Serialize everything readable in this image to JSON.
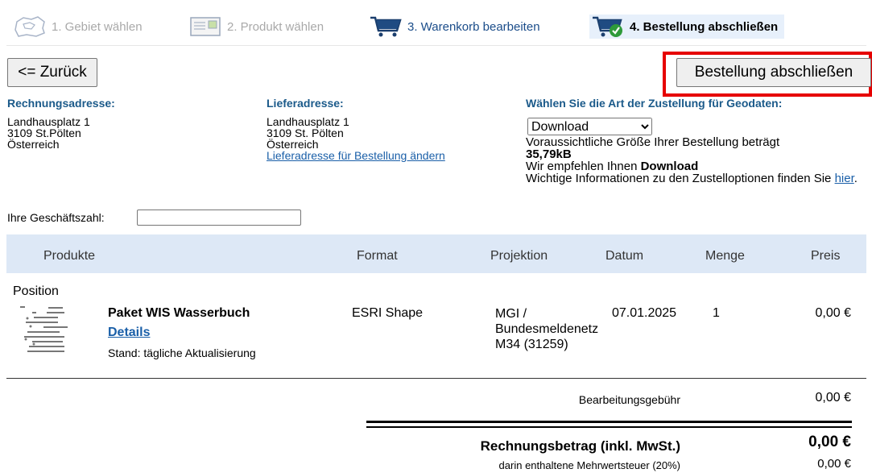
{
  "steps": [
    {
      "label": "1. Gebiet wählen",
      "icon": "map-region-icon",
      "state": "inactive"
    },
    {
      "label": "2. Produkt wählen",
      "icon": "product-sheet-icon",
      "state": "inactive"
    },
    {
      "label": "3. Warenkorb bearbeiten",
      "icon": "shopping-cart-icon",
      "state": "active"
    },
    {
      "label": "4. Bestellung abschließen",
      "icon": "cart-check-icon",
      "state": "current"
    }
  ],
  "nav": {
    "back_label": "<= Zurück",
    "finish_label": "Bestellung abschließen"
  },
  "billing": {
    "heading": "Rechnungsadresse:",
    "line1": "Landhausplatz 1",
    "line2": "3109 St.Pölten",
    "line3": "Österreich"
  },
  "delivery": {
    "heading": "Lieferadresse:",
    "line1": "Landhausplatz 1",
    "line2": "3109 St. Pölten",
    "line3": "Österreich",
    "change_link": "Lieferadresse für Bestellung ändern"
  },
  "shipping": {
    "heading": "Wählen Sie die Art der Zustellung für Geodaten:",
    "selected": "Download",
    "size_text": "Voraussichtliche Größe Ihrer Bestellung beträgt",
    "size_value": "35,79kB",
    "recommend_prefix": "Wir empfehlen Ihnen ",
    "recommend_value": "Download",
    "info_text": "Wichtige Informationen zu den Zustelloptionen finden Sie ",
    "info_link": "hier",
    "info_suffix": "."
  },
  "reference": {
    "label": "Ihre Geschäftszahl:",
    "value": ""
  },
  "table": {
    "headers": {
      "products": "Produkte",
      "format": "Format",
      "projection": "Projektion",
      "date": "Datum",
      "quantity": "Menge",
      "price": "Preis"
    },
    "position_label": "Position",
    "rows": [
      {
        "name": "Paket WIS Wasserbuch",
        "details": "Details",
        "status": "Stand: tägliche Aktualisierung",
        "format": "ESRI Shape",
        "projection_1": "MGI /",
        "projection_2": "Bundesmeldenetz",
        "projection_3": "M34 (31259)",
        "date": "07.01.2025",
        "quantity": "1",
        "price": "0,00 €"
      }
    ]
  },
  "totals": {
    "fee_label": "Bearbeitungsgebühr",
    "fee_value": "0,00 €",
    "total_label": "Rechnungsbetrag (inkl. MwSt.)",
    "total_value": "0,00 €",
    "vat_label": "darin enthaltene Mehrwertsteuer (20%)",
    "vat_value": "0,00 €"
  },
  "colors": {
    "accent": "#1b5a8a",
    "link": "#1a5fa8",
    "header_bg": "#dde8f6",
    "highlight": "#e60000"
  }
}
